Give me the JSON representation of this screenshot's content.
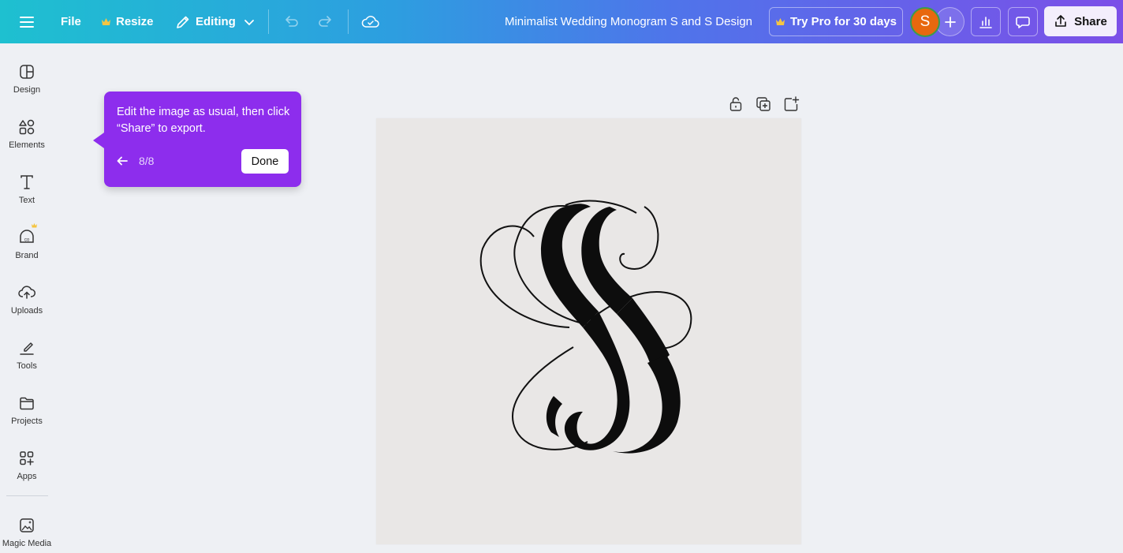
{
  "topbar": {
    "menu_icon": "hamburger-menu-icon",
    "file_label": "File",
    "resize_label": "Resize",
    "editing_label": "Editing",
    "document_title": "Minimalist Wedding Monogram S and S Design",
    "try_pro_label": "Try Pro for 30 days",
    "avatar_initial": "S",
    "share_label": "Share",
    "accent_gold": "#f5c542"
  },
  "sidebar": {
    "items": [
      {
        "label": "Design",
        "icon": "design-layout-icon"
      },
      {
        "label": "Elements",
        "icon": "elements-shapes-icon"
      },
      {
        "label": "Text",
        "icon": "text-t-icon"
      },
      {
        "label": "Brand",
        "icon": "brand-kit-icon"
      },
      {
        "label": "Uploads",
        "icon": "cloud-upload-icon"
      },
      {
        "label": "Tools",
        "icon": "draw-tools-icon"
      },
      {
        "label": "Projects",
        "icon": "folder-icon"
      },
      {
        "label": "Apps",
        "icon": "apps-grid-icon"
      },
      {
        "label": "Magic Media",
        "icon": "magic-media-icon"
      }
    ]
  },
  "tooltip": {
    "message": "Edit the image as usual, then click “Share” to export.",
    "step": "8/8",
    "done_label": "Done",
    "color": "#8d2ded"
  },
  "canvas": {
    "background": "#e9e7e6",
    "artwork": "S and S monogram"
  }
}
